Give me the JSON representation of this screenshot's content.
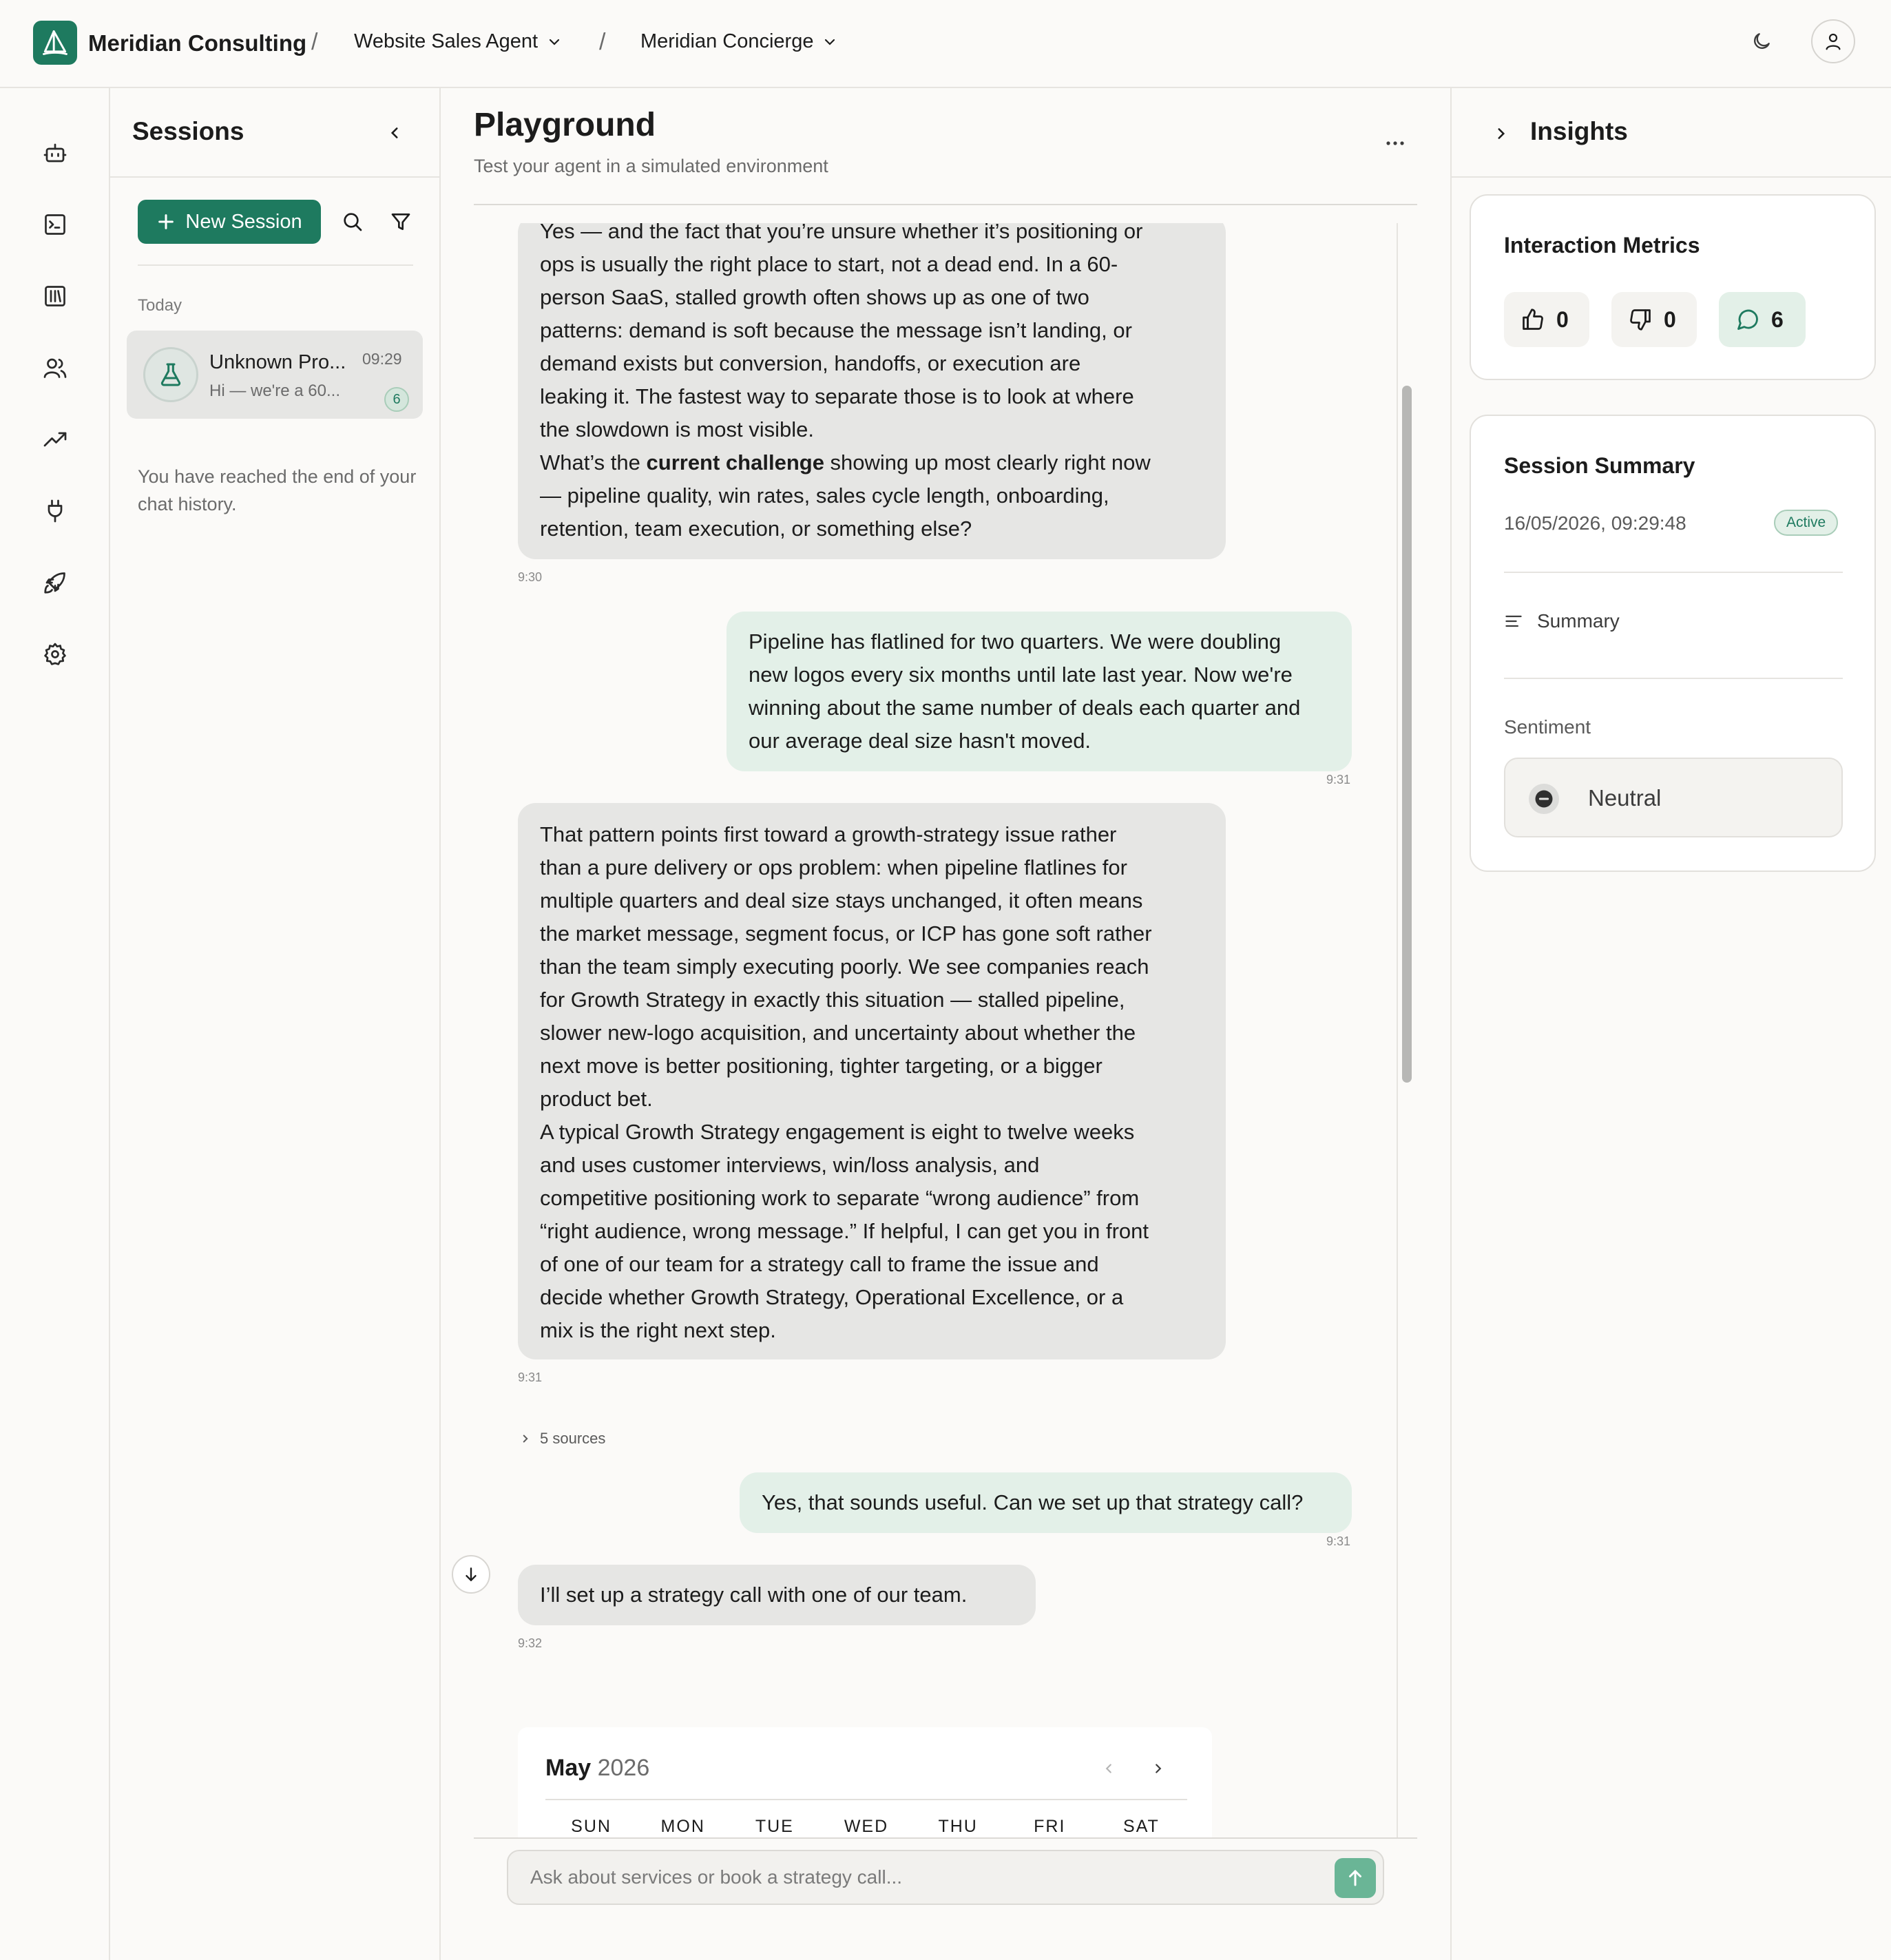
{
  "topbar": {
    "org_name": "Meridian Consulting",
    "separator": "/",
    "agent_select": "Website Sales Agent",
    "persona_select": "Meridian Concierge"
  },
  "rail": {
    "icons": [
      "bot-icon",
      "terminal-icon",
      "library-icon",
      "users-icon",
      "trending-up-icon",
      "plug-icon",
      "rocket-icon",
      "settings-icon"
    ]
  },
  "sessions": {
    "title": "Sessions",
    "new_session_label": "New Session",
    "group_label": "Today",
    "items": [
      {
        "name": "Unknown Pro...",
        "time": "09:29",
        "preview": "Hi — we're a 60...",
        "count": "6"
      }
    ],
    "end_text": "You have reached the end of your chat history."
  },
  "playground": {
    "title": "Playground",
    "subtitle": "Test your agent in a simulated environment",
    "messages": [
      {
        "role": "agent",
        "text_a": "Yes — and the fact that you’re unsure whether it’s positioning or\nops is usually the right place to start, not a dead end. In a 60-\nperson SaaS, stalled growth often shows up as one of two\npatterns: demand is soft because the message isn’t landing, or\ndemand exists but conversion, handoffs, or execution are\nleaking it. The fastest way to separate those is to look at where\nthe slowdown is most visible.",
        "text_b_pre": "What’s the ",
        "text_b_bold": "current challenge",
        "text_b_post": " showing up most clearly right now\n— pipeline quality, win rates, sales cycle length, onboarding,\nretention, team execution, or something else?",
        "time": "9:30"
      },
      {
        "role": "user",
        "text": "Pipeline has flatlined for two quarters. We were doubling\nnew logos every six months until late last year. Now we're\nwinning about the same number of deals each quarter and\nour average deal size hasn't moved.",
        "time": "9:31"
      },
      {
        "role": "agent",
        "text": "That pattern points first toward a growth-strategy issue rather\nthan a pure delivery or ops problem: when pipeline flatlines for\nmultiple quarters and deal size stays unchanged, it often means\nthe market message, segment focus, or ICP has gone soft rather\nthan the team simply executing poorly. We see companies reach\nfor Growth Strategy in exactly this situation — stalled pipeline,\nslower new-logo acquisition, and uncertainty about whether the\nnext move is better positioning, tighter targeting, or a bigger\nproduct bet.\nA typical Growth Strategy engagement is eight to twelve weeks\nand uses customer interviews, win/loss analysis, and\ncompetitive positioning work to separate “wrong audience” from\n“right audience, wrong message.” If helpful, I can get you in front\nof one of our team for a strategy call to frame the issue and\ndecide whether Growth Strategy, Operational Excellence, or a\nmix is the right next step.",
        "time": "9:31",
        "sources": "5 sources"
      },
      {
        "role": "user",
        "text": "Yes, that sounds useful. Can we set up that strategy call?",
        "time": "9:31"
      },
      {
        "role": "agent",
        "text": "I’ll set up a strategy call with one of our team.",
        "time": "9:32"
      }
    ],
    "calendar": {
      "month": "May",
      "year": "2026",
      "weekdays": [
        "SUN",
        "MON",
        "TUE",
        "WED",
        "THU",
        "FRI",
        "SAT"
      ]
    },
    "composer_placeholder": "Ask about services or book a strategy call..."
  },
  "insights": {
    "title": "Insights",
    "metrics_title": "Interaction Metrics",
    "thumbs_up": "0",
    "thumbs_down": "0",
    "messages": "6",
    "summary_title": "Session Summary",
    "session_datetime": "16/05/2026, 09:29:48",
    "status": "Active",
    "summary_link": "Summary",
    "sentiment_label": "Sentiment",
    "sentiment_value": "Neutral"
  },
  "colors": {
    "brand": "#1e7a5f",
    "user_bubble": "#e3f0e8",
    "agent_bubble": "#e6e6e4",
    "send_button": "#6ab596"
  }
}
